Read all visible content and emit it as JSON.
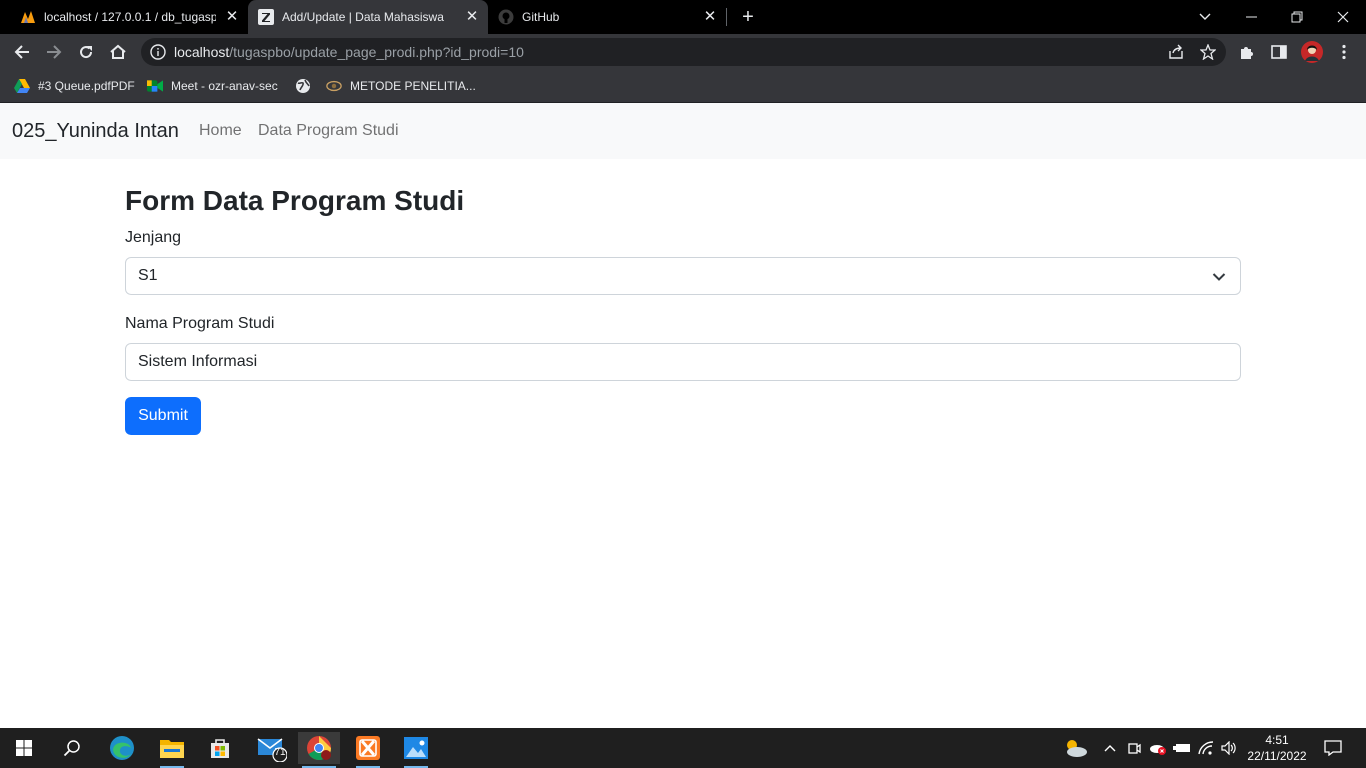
{
  "browser": {
    "tabs": [
      {
        "title": "localhost / 127.0.0.1 / db_tugaspbo",
        "icon": "phpmyadmin-icon"
      },
      {
        "title": "Add/Update | Data Mahasiswa",
        "icon": "z-icon"
      },
      {
        "title": "GitHub",
        "icon": "github-icon"
      }
    ],
    "url_host": "localhost",
    "url_path": "/tugaspbo/update_page_prodi.php?id_prodi=10",
    "bookmarks": [
      {
        "label": "#3 Queue.pdfPDF",
        "icon": "google-drive-icon"
      },
      {
        "label": "Meet - ozr-anav-sec",
        "icon": "google-meet-icon"
      },
      {
        "label": "",
        "icon": "globe-icon"
      },
      {
        "label": "METODE PENELITIA...",
        "icon": "eye-icon"
      }
    ]
  },
  "page": {
    "brand": "025_Yuninda Intan",
    "nav": [
      "Home",
      "Data Program Studi"
    ],
    "form": {
      "title": "Form Data Program Studi",
      "jenjang_label": "Jenjang",
      "jenjang_value": "S1",
      "prodi_label": "Nama Program Studi",
      "prodi_value": "Sistem Informasi",
      "submit_label": "Submit"
    }
  },
  "taskbar": {
    "mail_badge": "71",
    "time": "4:51",
    "date": "22/11/2022"
  },
  "colors": {
    "primary": "#0d6efd",
    "navbar_bg": "#f8f9fa",
    "tab_active": "#35363a"
  }
}
